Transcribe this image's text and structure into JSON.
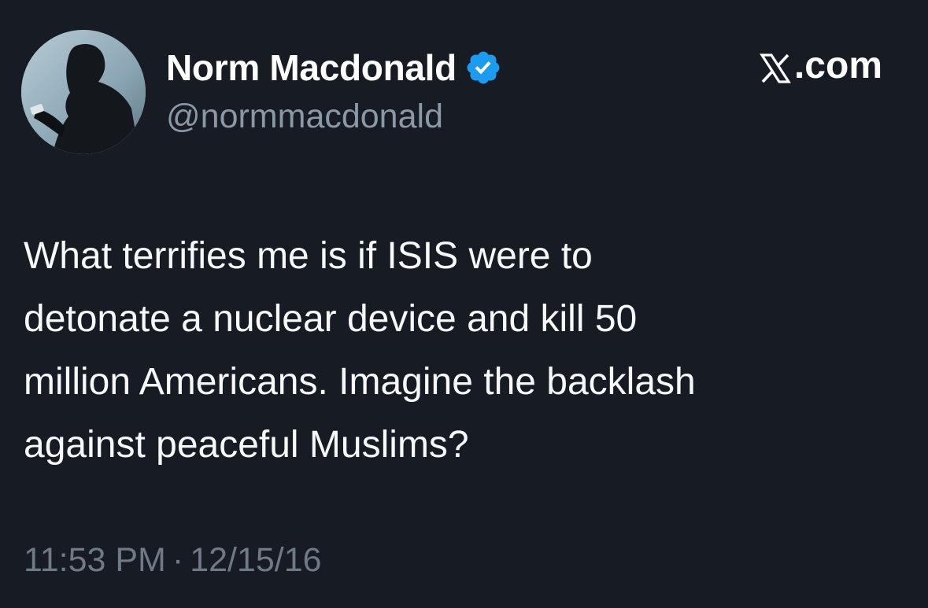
{
  "author": {
    "display_name": "Norm Macdonald",
    "handle": "@normmacdonald",
    "verified": true,
    "avatar_icon": "profile-photo-silhouette"
  },
  "site": {
    "label": ".com",
    "logo_icon": "x-logo-icon"
  },
  "tweet": {
    "text": "What terrifies me is if ISIS were to\ndetonate a nuclear device and kill 50\nmillion Americans. Imagine the backlash\nagainst peaceful Muslims?",
    "time": "11:53 PM",
    "separator": "·",
    "date": "12/15/16"
  },
  "colors": {
    "background": "#161b24",
    "text_primary": "#f7f9f9",
    "text_secondary": "#8b98a5",
    "verified_blue": "#1d9bf0"
  }
}
